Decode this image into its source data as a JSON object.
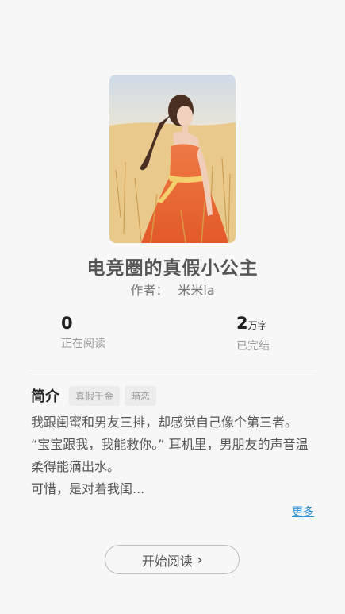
{
  "book": {
    "title": "电竞圈的真假小公主",
    "author_label": "作者：",
    "author_name": "米米la"
  },
  "stats": {
    "reading_count": "0",
    "reading_label": "正在阅读",
    "word_count": "2",
    "word_unit": "万字",
    "status_label": "已完结"
  },
  "intro": {
    "heading": "简介",
    "tags": [
      "真假千金",
      "暗恋"
    ],
    "lines": [
      "我跟闺蜜和男友三排，却感觉自己像个第三者。",
      "“宝宝跟我，我能救你。” 耳机里，男朋友的声音温柔得能滴出水。",
      "可惜，是对着我闺..."
    ],
    "more_label": "更多"
  },
  "actions": {
    "start_label": "开始阅读"
  },
  "icons": {
    "chevron": "chevron-right-icon"
  }
}
